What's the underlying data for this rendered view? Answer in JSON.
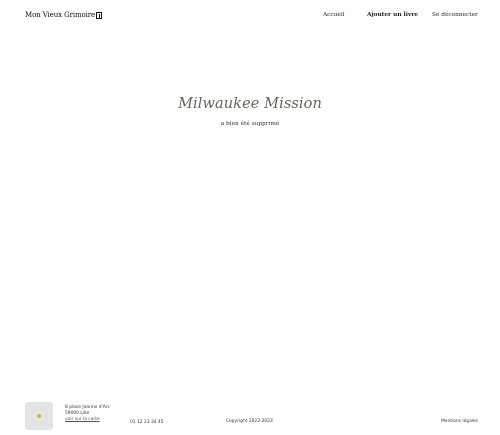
{
  "header": {
    "logo_text": "Mon Vieux Grimoire",
    "logo_icon": "book-icon",
    "nav": {
      "home": "Accueil",
      "add_book": "Ajouter un livre",
      "logout": "Se déconnecter"
    }
  },
  "main": {
    "book_title": "Milwaukee Mission",
    "message": "a bien été supprimé"
  },
  "footer": {
    "map_icon": "map-pin-icon",
    "address_line1": "8 place Jeanne d'Arc",
    "address_line2": "59000 Lille",
    "map_link": "voir sur la carte",
    "phone": "01 12 23 34 45",
    "copyright": "Copyright 2022-2023",
    "legal": "Mentions légales"
  },
  "colors": {
    "title": "#6b6258",
    "pin": "#e6a84a",
    "map_bg": "#e4e4e4"
  }
}
